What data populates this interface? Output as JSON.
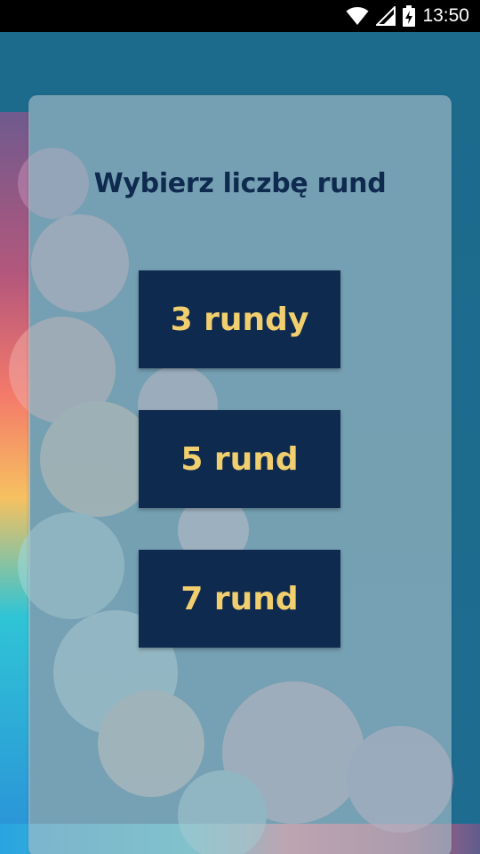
{
  "status_bar": {
    "time": "13:50",
    "icons": [
      "wifi-icon",
      "signal-icon",
      "battery-charging-icon"
    ]
  },
  "screen": {
    "title": "Wybierz liczbę rund",
    "options": [
      {
        "label": "3 rundy"
      },
      {
        "label": "5 rund"
      },
      {
        "label": "7 rund"
      }
    ]
  },
  "colors": {
    "background": "#1c6a8c",
    "card": "#a4bbc6",
    "title_text": "#0e2a4e",
    "button_bg": "#0e2a4e",
    "button_text": "#f2cf6e"
  }
}
